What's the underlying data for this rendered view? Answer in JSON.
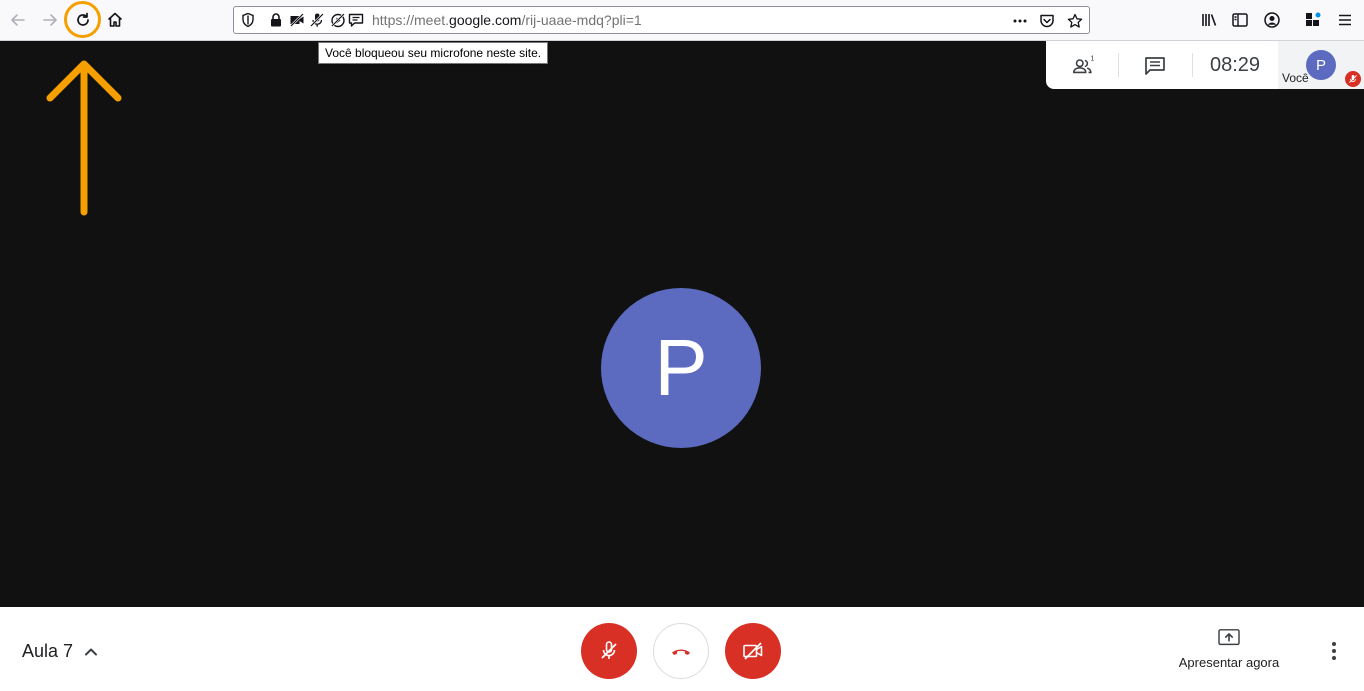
{
  "browser": {
    "url_prefix": "https://meet.",
    "url_domain": "google.com",
    "url_path": "/rij-uaae-mdq?pli=1",
    "tooltip": "Você bloqueou seu microfone neste site.",
    "icons": [
      "back-icon",
      "forward-icon",
      "reload-icon",
      "home-icon",
      "shield-icon",
      "lock-icon",
      "camera-blocked-icon",
      "mic-blocked-icon",
      "autoplay-blocked-icon",
      "notification-icon",
      "more-actions-icon",
      "pocket-icon",
      "bookmark-star-icon",
      "library-icon",
      "sidebar-icon",
      "account-icon",
      "extensions-icon",
      "hamburger-menu-icon"
    ]
  },
  "meet": {
    "participant_initial": "P",
    "participants_count": "1",
    "clock": "08:29",
    "self_label": "Você",
    "self_initial": "P",
    "meeting_name": "Aula 7",
    "present_label": "Apresentar agora"
  },
  "colors": {
    "accent_red": "#d93025",
    "avatar": "#5c6bc0",
    "annotation": "#f5a000",
    "stage": "#111111"
  }
}
